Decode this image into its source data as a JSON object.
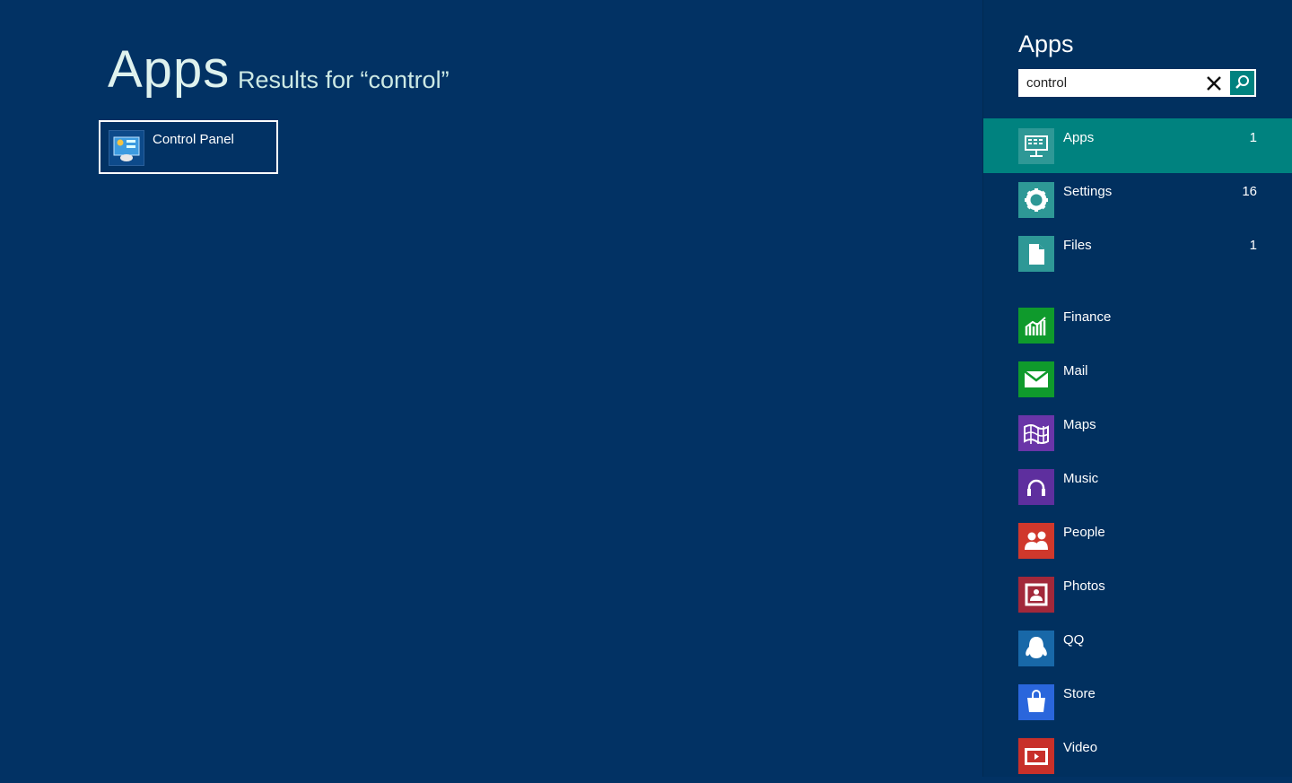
{
  "main": {
    "title": "Apps",
    "subtitle": "Results for “control”",
    "results": [
      {
        "label": "Control Panel",
        "icon": "control-panel-icon"
      }
    ]
  },
  "pane": {
    "title": "Apps",
    "search": {
      "value": "control",
      "clear_icon": "close-icon",
      "search_icon": "search-icon"
    },
    "accent": "#00827f",
    "scopes": [
      {
        "label": "Apps",
        "count": "1",
        "icon": "apps-icon",
        "color": "#2e9896",
        "selected": true
      },
      {
        "label": "Settings",
        "count": "16",
        "icon": "gear-icon",
        "color": "#2e9896",
        "selected": false
      },
      {
        "label": "Files",
        "count": "1",
        "icon": "file-icon",
        "color": "#2e9896",
        "selected": false
      }
    ],
    "apps": [
      {
        "label": "Finance",
        "icon": "finance-icon",
        "color": "#0f9a2c"
      },
      {
        "label": "Mail",
        "icon": "mail-icon",
        "color": "#0f9a2c"
      },
      {
        "label": "Maps",
        "icon": "maps-icon",
        "color": "#6a35a8"
      },
      {
        "label": "Music",
        "icon": "headphones-icon",
        "color": "#5e2f9e"
      },
      {
        "label": "People",
        "icon": "people-icon",
        "color": "#d0382c"
      },
      {
        "label": "Photos",
        "icon": "photo-icon",
        "color": "#a2283a"
      },
      {
        "label": "QQ",
        "icon": "qq-penguin-icon",
        "color": "#1868a8"
      },
      {
        "label": "Store",
        "icon": "store-bag-icon",
        "color": "#2a66dc"
      },
      {
        "label": "Video",
        "icon": "video-play-icon",
        "color": "#c8302a"
      }
    ]
  }
}
